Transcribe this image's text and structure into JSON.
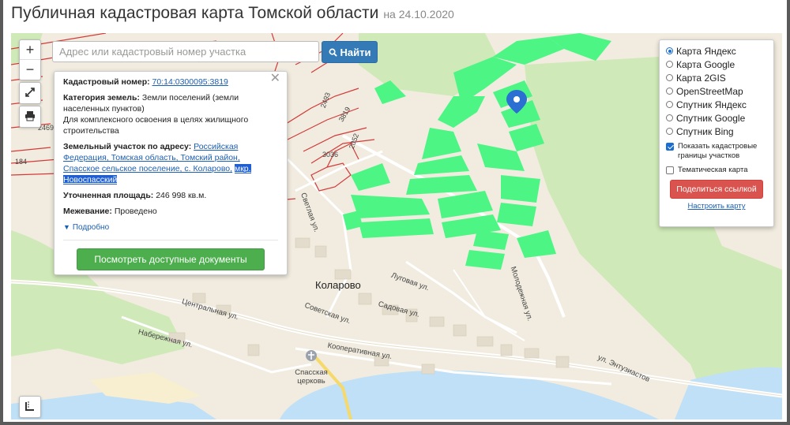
{
  "header": {
    "title": "Публичная кадастровая карта Томской области",
    "date": "на 24.10.2020"
  },
  "controls": {
    "zoom_in": "+",
    "zoom_out": "−"
  },
  "search": {
    "placeholder": "Адрес или кадастровый номер участка",
    "button_label": "Найти"
  },
  "info": {
    "cadastral_label": "Кадастровый номер:",
    "cadastral_value": "70:14:0300095:3819",
    "category_label": "Категория земель:",
    "category_value": "Земли поселений (земли населенных пунктов)",
    "category_note": "Для комплексного освоения в целях жилищного строительства",
    "address_label": "Земельный участок по адресу:",
    "address_value": "Российская Федерация, Томская область, Томский район, Спасское сельское поселение, с. Коларово,",
    "address_highlight": "мкр. Новоспасский",
    "area_label": "Уточненная площадь:",
    "area_value": "246 998 кв.м.",
    "survey_label": "Межевание:",
    "survey_value": "Проведено",
    "details_link": "Подробно",
    "docs_button": "Посмотреть доступные документы"
  },
  "layers": {
    "options": [
      {
        "label": "Карта Яндекс",
        "selected": true
      },
      {
        "label": "Карта Google",
        "selected": false
      },
      {
        "label": "Карта 2GIS",
        "selected": false
      },
      {
        "label": "OpenStreetMap",
        "selected": false
      },
      {
        "label": "Спутник Яндекс",
        "selected": false
      },
      {
        "label": "Спутник Google",
        "selected": false
      },
      {
        "label": "Спутник Bing",
        "selected": false
      }
    ],
    "show_borders_label": "Показать кадастровые границы участков",
    "show_borders_checked": true,
    "thematic_label": "Тематическая карта",
    "thematic_checked": false,
    "share_button": "Поделиться ссылкой",
    "configure_link": "Настроить карту"
  },
  "map_labels": {
    "village": "Коларово",
    "church": "Спасская церковь",
    "streets": [
      "Центральная ул.",
      "Советская ул.",
      "Садовая ул.",
      "Луговая ул.",
      "Набережная ул.",
      "Кооперативная ул.",
      "Молодежная ул.",
      "ул. Энтузиастов",
      "Светлая ул."
    ],
    "parcel_numbers": [
      "2493",
      "3819",
      "2052",
      "3036",
      "2469",
      "184"
    ]
  },
  "colors": {
    "parcel_fill": "#4cf584",
    "cadastral_lines": "#d23b3b",
    "water": "#bfe0f7",
    "forest": "#cfe9b8",
    "land": "#f1ecdf"
  }
}
